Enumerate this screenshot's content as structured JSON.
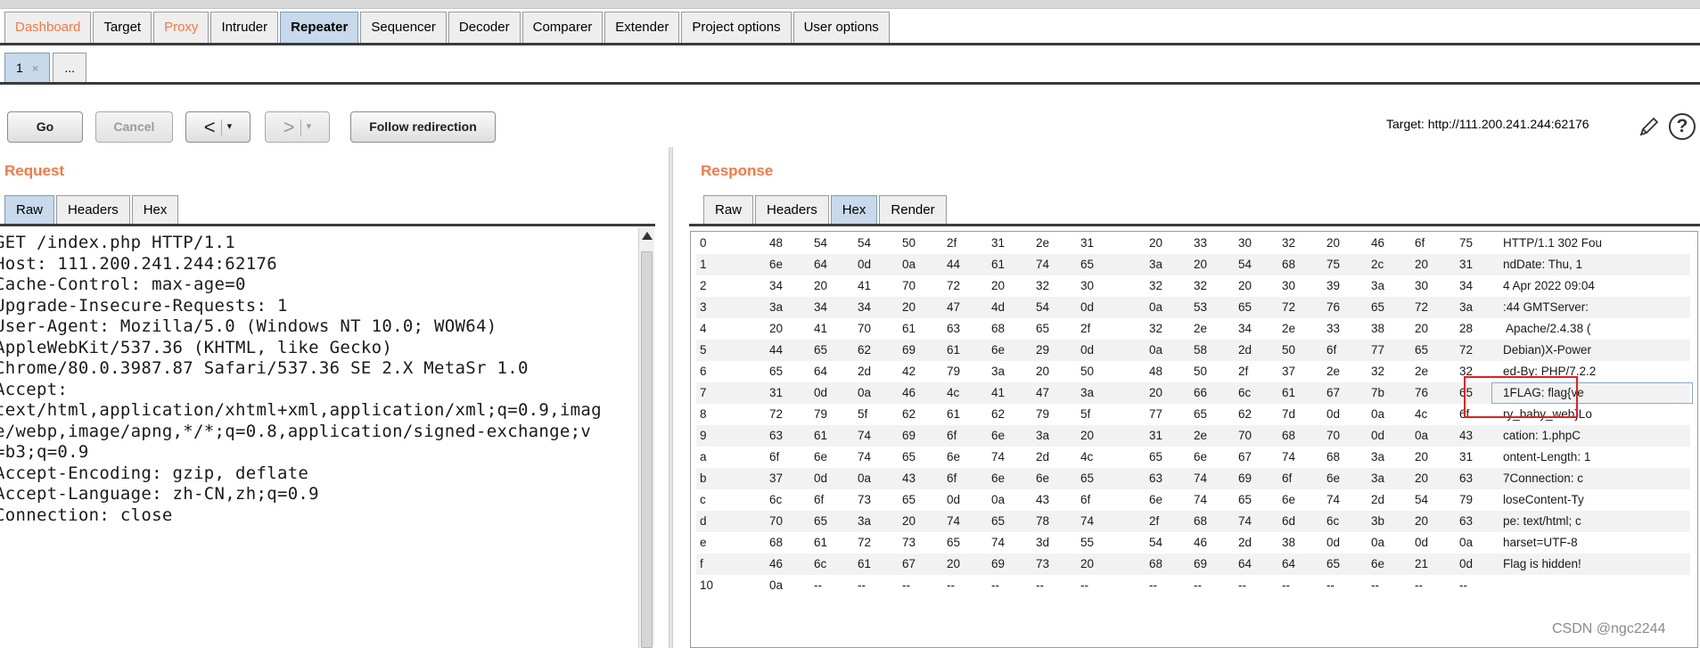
{
  "main_tabs": [
    "Dashboard",
    "Target",
    "Proxy",
    "Intruder",
    "Repeater",
    "Sequencer",
    "Decoder",
    "Comparer",
    "Extender",
    "Project options",
    "User options"
  ],
  "sub_tabs": {
    "current": "1",
    "close": "×",
    "more": "..."
  },
  "toolbar": {
    "go": "Go",
    "cancel": "Cancel",
    "back": "<",
    "forward": ">",
    "dropdown": "▾",
    "follow": "Follow redirection",
    "target": "Target: http://111.200.241.244:62176"
  },
  "request": {
    "title": "Request",
    "tabs": [
      "Raw",
      "Headers",
      "Hex"
    ],
    "lines": [
      "GET /index.php HTTP/1.1",
      "Host: 111.200.241.244:62176",
      "Cache-Control: max-age=0",
      "Upgrade-Insecure-Requests: 1",
      "User-Agent: Mozilla/5.0 (Windows NT 10.0; WOW64)",
      "AppleWebKit/537.36 (KHTML, like Gecko)",
      "Chrome/80.0.3987.87 Safari/537.36 SE 2.X MetaSr 1.0",
      "Accept:",
      "text/html,application/xhtml+xml,application/xml;q=0.9,imag",
      "e/webp,image/apng,*/*;q=0.8,application/signed-exchange;v",
      "=b3;q=0.9",
      "Accept-Encoding: gzip, deflate",
      "Accept-Language: zh-CN,zh;q=0.9",
      "Connection: close"
    ]
  },
  "response": {
    "title": "Response",
    "tabs": [
      "Raw",
      "Headers",
      "Hex",
      "Render"
    ],
    "hex_rows": [
      {
        "off": "0",
        "bytes": [
          "48",
          "54",
          "54",
          "50",
          "2f",
          "31",
          "2e",
          "31",
          "20",
          "33",
          "30",
          "32",
          "20",
          "46",
          "6f",
          "75"
        ],
        "ascii": "HTTP/1.1 302 Fou"
      },
      {
        "off": "1",
        "bytes": [
          "6e",
          "64",
          "0d",
          "0a",
          "44",
          "61",
          "74",
          "65",
          "3a",
          "20",
          "54",
          "68",
          "75",
          "2c",
          "20",
          "31"
        ],
        "ascii": "ndDate: Thu, 1"
      },
      {
        "off": "2",
        "bytes": [
          "34",
          "20",
          "41",
          "70",
          "72",
          "20",
          "32",
          "30",
          "32",
          "32",
          "20",
          "30",
          "39",
          "3a",
          "30",
          "34"
        ],
        "ascii": "4 Apr 2022 09:04"
      },
      {
        "off": "3",
        "bytes": [
          "3a",
          "34",
          "34",
          "20",
          "47",
          "4d",
          "54",
          "0d",
          "0a",
          "53",
          "65",
          "72",
          "76",
          "65",
          "72",
          "3a"
        ],
        "ascii": ":44 GMTServer:"
      },
      {
        "off": "4",
        "bytes": [
          "20",
          "41",
          "70",
          "61",
          "63",
          "68",
          "65",
          "2f",
          "32",
          "2e",
          "34",
          "2e",
          "33",
          "38",
          "20",
          "28"
        ],
        "ascii": " Apache/2.4.38 ("
      },
      {
        "off": "5",
        "bytes": [
          "44",
          "65",
          "62",
          "69",
          "61",
          "6e",
          "29",
          "0d",
          "0a",
          "58",
          "2d",
          "50",
          "6f",
          "77",
          "65",
          "72"
        ],
        "ascii": "Debian)X-Power"
      },
      {
        "off": "6",
        "bytes": [
          "65",
          "64",
          "2d",
          "42",
          "79",
          "3a",
          "20",
          "50",
          "48",
          "50",
          "2f",
          "37",
          "2e",
          "32",
          "2e",
          "32"
        ],
        "ascii": "ed-By: PHP/7.2.2"
      },
      {
        "off": "7",
        "bytes": [
          "31",
          "0d",
          "0a",
          "46",
          "4c",
          "41",
          "47",
          "3a",
          "20",
          "66",
          "6c",
          "61",
          "67",
          "7b",
          "76",
          "65"
        ],
        "ascii": "1FLAG: flag{ve"
      },
      {
        "off": "8",
        "bytes": [
          "72",
          "79",
          "5f",
          "62",
          "61",
          "62",
          "79",
          "5f",
          "77",
          "65",
          "62",
          "7d",
          "0d",
          "0a",
          "4c",
          "6f"
        ],
        "ascii": "ry_baby_web}Lo"
      },
      {
        "off": "9",
        "bytes": [
          "63",
          "61",
          "74",
          "69",
          "6f",
          "6e",
          "3a",
          "20",
          "31",
          "2e",
          "70",
          "68",
          "70",
          "0d",
          "0a",
          "43"
        ],
        "ascii": "cation: 1.phpC"
      },
      {
        "off": "a",
        "bytes": [
          "6f",
          "6e",
          "74",
          "65",
          "6e",
          "74",
          "2d",
          "4c",
          "65",
          "6e",
          "67",
          "74",
          "68",
          "3a",
          "20",
          "31"
        ],
        "ascii": "ontent-Length: 1"
      },
      {
        "off": "b",
        "bytes": [
          "37",
          "0d",
          "0a",
          "43",
          "6f",
          "6e",
          "6e",
          "65",
          "63",
          "74",
          "69",
          "6f",
          "6e",
          "3a",
          "20",
          "63"
        ],
        "ascii": "7Connection: c"
      },
      {
        "off": "c",
        "bytes": [
          "6c",
          "6f",
          "73",
          "65",
          "0d",
          "0a",
          "43",
          "6f",
          "6e",
          "74",
          "65",
          "6e",
          "74",
          "2d",
          "54",
          "79"
        ],
        "ascii": "loseContent-Ty"
      },
      {
        "off": "d",
        "bytes": [
          "70",
          "65",
          "3a",
          "20",
          "74",
          "65",
          "78",
          "74",
          "2f",
          "68",
          "74",
          "6d",
          "6c",
          "3b",
          "20",
          "63"
        ],
        "ascii": "pe: text/html; c"
      },
      {
        "off": "e",
        "bytes": [
          "68",
          "61",
          "72",
          "73",
          "65",
          "74",
          "3d",
          "55",
          "54",
          "46",
          "2d",
          "38",
          "0d",
          "0a",
          "0d",
          "0a"
        ],
        "ascii": "harset=UTF-8"
      },
      {
        "off": "f",
        "bytes": [
          "46",
          "6c",
          "61",
          "67",
          "20",
          "69",
          "73",
          "20",
          "68",
          "69",
          "64",
          "64",
          "65",
          "6e",
          "21",
          "0d"
        ],
        "ascii": "Flag is hidden!"
      },
      {
        "off": "10",
        "bytes": [
          "0a",
          "--",
          "--",
          "--",
          "--",
          "--",
          "--",
          "--",
          "--",
          "--",
          "--",
          "--",
          "--",
          "--",
          "--",
          "--"
        ],
        "ascii": ""
      }
    ]
  },
  "watermark": "CSDN @ngc2244",
  "colors": {
    "accent": "#f37a46",
    "active_tab": "#c7d9ea",
    "highlight": "#e02020"
  }
}
